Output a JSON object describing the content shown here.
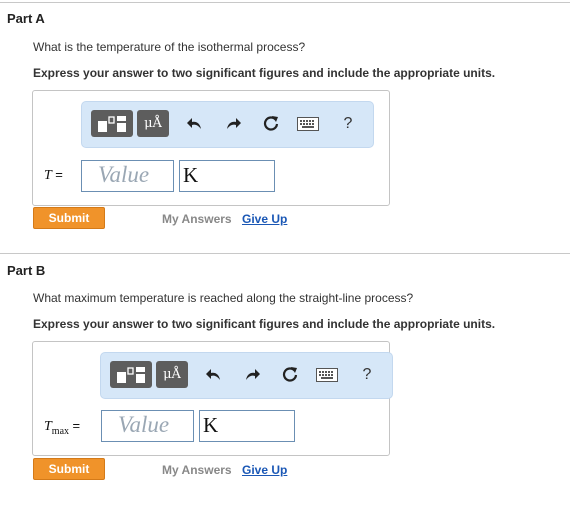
{
  "part_a": {
    "title": "Part A",
    "question": "What is the temperature of the isothermal process?",
    "instruction": "Express your answer to two significant figures and include the appropriate units.",
    "variable": "T",
    "equals": "=",
    "value_placeholder": "Value",
    "units_value": "K",
    "submit_label": "Submit",
    "my_answers_label": "My Answers",
    "give_up_label": "Give Up"
  },
  "part_b": {
    "title": "Part B",
    "question": "What maximum temperature is reached along the straight-line process?",
    "instruction": "Express your answer to two significant figures and include the appropriate units.",
    "variable": "T",
    "variable_subscript": "max",
    "equals": "=",
    "value_placeholder": "Value",
    "units_value": "K",
    "submit_label": "Submit",
    "my_answers_label": "My Answers",
    "give_up_label": "Give Up"
  },
  "toolbar": {
    "units_button_label": "μÅ",
    "help_label": "?",
    "icons": [
      "templates-icon",
      "units-icon",
      "undo-icon",
      "redo-icon",
      "reset-icon",
      "keyboard-icon",
      "help-icon"
    ]
  },
  "colors": {
    "submit": "#f0932a",
    "toolbar_bg": "#d6e7f8",
    "link": "#1a57b5"
  }
}
